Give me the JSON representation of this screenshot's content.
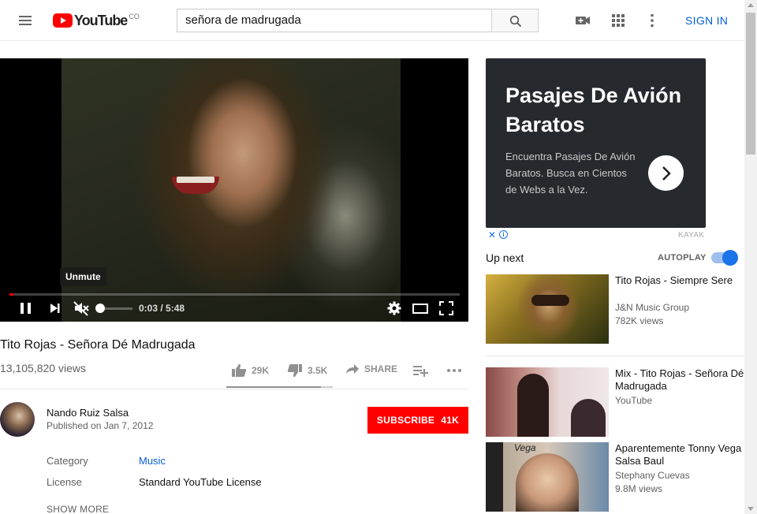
{
  "header": {
    "logo_text": "YouTube",
    "logo_country": "CO",
    "search_value": "señora de madrugada",
    "sign_in": "SIGN IN"
  },
  "player": {
    "tooltip": "Unmute",
    "time": "0:03 / 5:48",
    "progress_fraction": 0.009
  },
  "video": {
    "title": "Tito Rojas - Señora Dé Madrugada",
    "views": "13,105,820 views",
    "likes": "29K",
    "dislikes": "3.5K",
    "share": "SHARE",
    "like_fraction": 0.89
  },
  "channel": {
    "name": "Nando Ruiz Salsa",
    "published": "Published on Jan 7, 2012",
    "subscribe_label": "SUBSCRIBE",
    "subscriber_count": "41K"
  },
  "meta": {
    "category_label": "Category",
    "category_value": "Music",
    "license_label": "License",
    "license_value": "Standard YouTube License",
    "show_more": "SHOW MORE"
  },
  "ad": {
    "title": "Pasajes De Avión Baratos",
    "description": "Encuentra Pasajes De Avión Baratos. Busca en Cientos de Webs a la Vez.",
    "brand": "KAYAK"
  },
  "sidebar": {
    "up_next": "Up next",
    "autoplay": "AUTOPLAY",
    "autoplay_on": true,
    "recommendations": [
      {
        "title": "Tito Rojas - Siempre Sere",
        "channel": "J&N Music Group",
        "views": "782K views"
      },
      {
        "title": "Mix - Tito Rojas - Señora Dé Madrugada",
        "channel": "YouTube",
        "views": ""
      },
      {
        "title": "Aparentemente Tonny Vega Salsa Baul",
        "channel": "Stephany Cuevas",
        "views": "9.8M views",
        "thumb_text": "Vega"
      }
    ]
  }
}
